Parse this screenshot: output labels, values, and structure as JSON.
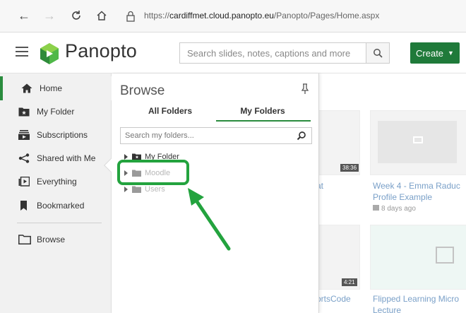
{
  "browser": {
    "url_host": "cardiffmet.cloud.panopto.eu",
    "url_prefix": "https://",
    "url_path": "/Panopto/Pages/Home.aspx"
  },
  "header": {
    "logo_text": "Panopto",
    "search_placeholder": "Search slides, notes, captions and more",
    "create_label": "Create"
  },
  "sidebar": {
    "items": [
      {
        "label": "Home",
        "icon": "home-icon"
      },
      {
        "label": "My Folder",
        "icon": "my-folder-icon"
      },
      {
        "label": "Subscriptions",
        "icon": "subscriptions-icon"
      },
      {
        "label": "Shared with Me",
        "icon": "share-icon"
      },
      {
        "label": "Everything",
        "icon": "everything-icon"
      },
      {
        "label": "Bookmarked",
        "icon": "bookmark-icon"
      },
      {
        "label": "Browse",
        "icon": "browse-folder-icon"
      }
    ]
  },
  "browse": {
    "title": "Browse",
    "tabs": [
      {
        "label": "All Folders"
      },
      {
        "label": "My Folders"
      }
    ],
    "search_placeholder": "Search my folders...",
    "tree": [
      {
        "label": "My Folder"
      },
      {
        "label": "Moodle"
      },
      {
        "label": "Users"
      }
    ]
  },
  "background": {
    "titles": [
      "at",
      "Week 4 - Emma Raduc",
      "Profile Example",
      "ortsCode",
      "Flipped Learning Micro",
      "Lecture"
    ],
    "meta": "8 days ago",
    "duration": "38:36",
    "duration2": "4:21"
  },
  "colors": {
    "accent": "#2a8c3e",
    "create": "#1f7a3a",
    "highlight": "#23a33e"
  }
}
